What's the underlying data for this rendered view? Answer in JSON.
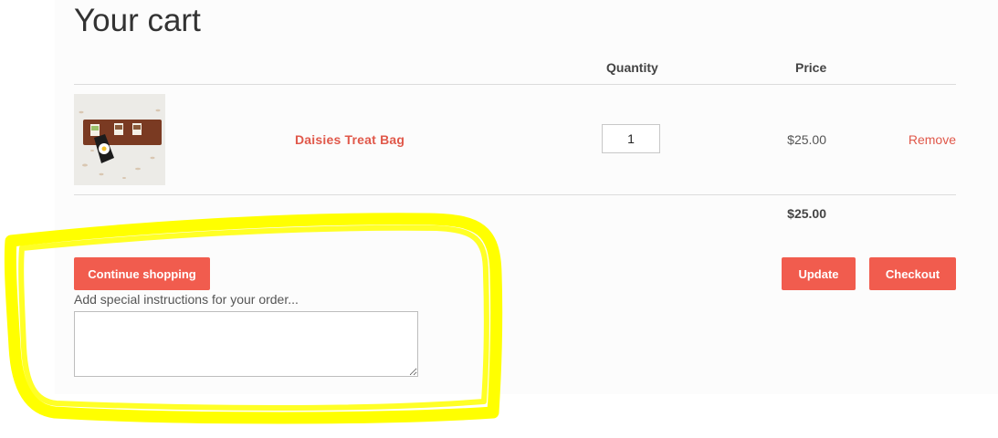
{
  "page": {
    "title": "Your cart"
  },
  "table": {
    "headers": {
      "quantity": "Quantity",
      "price": "Price"
    }
  },
  "items": [
    {
      "name": "Daisies Treat Bag",
      "quantity": "1",
      "price": "$25.00",
      "remove_label": "Remove",
      "thumbnail_icon": "product-photo"
    }
  ],
  "subtotal": "$25.00",
  "actions": {
    "continue_label": "Continue shopping",
    "update_label": "Update",
    "checkout_label": "Checkout"
  },
  "notes": {
    "label": "Add special instructions for your order..."
  },
  "colors": {
    "accent": "#f15c4e",
    "link": "#e0584a",
    "annotation_highlight": "#ffff00"
  }
}
